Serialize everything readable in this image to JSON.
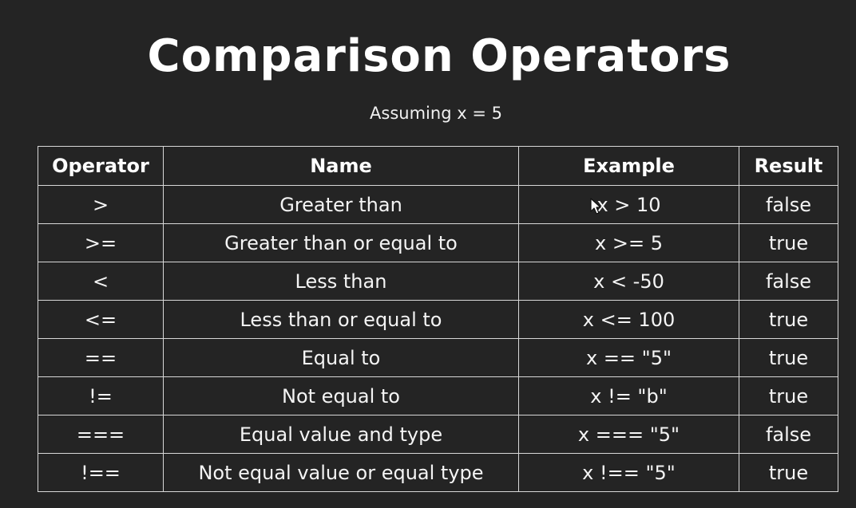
{
  "slide": {
    "title": "Comparison Operators",
    "subtitle": "Assuming x = 5"
  },
  "table": {
    "headers": {
      "operator": "Operator",
      "name": "Name",
      "example": "Example",
      "result": "Result"
    },
    "rows": [
      {
        "operator": ">",
        "name": "Greater than",
        "example": "x > 10",
        "result": "false"
      },
      {
        "operator": ">=",
        "name": "Greater than or equal to",
        "example": "x >= 5",
        "result": "true"
      },
      {
        "operator": "<",
        "name": "Less than",
        "example": "x < -50",
        "result": "false"
      },
      {
        "operator": "<=",
        "name": "Less than or equal to",
        "example": "x <= 100",
        "result": "true"
      },
      {
        "operator": "==",
        "name": "Equal to",
        "example": "x == \"5\"",
        "result": "true"
      },
      {
        "operator": "!=",
        "name": "Not equal to",
        "example": "x != \"b\"",
        "result": "true"
      },
      {
        "operator": "===",
        "name": "Equal value and type",
        "example": "x === \"5\"",
        "result": "false"
      },
      {
        "operator": "!==",
        "name": "Not equal value or equal type",
        "example": "x !== \"5\"",
        "result": "true"
      }
    ]
  },
  "cursor_icon": "mouse-pointer-icon",
  "colors": {
    "background": "#242424",
    "text": "#f4f4f4",
    "border": "#d8d8d8"
  }
}
